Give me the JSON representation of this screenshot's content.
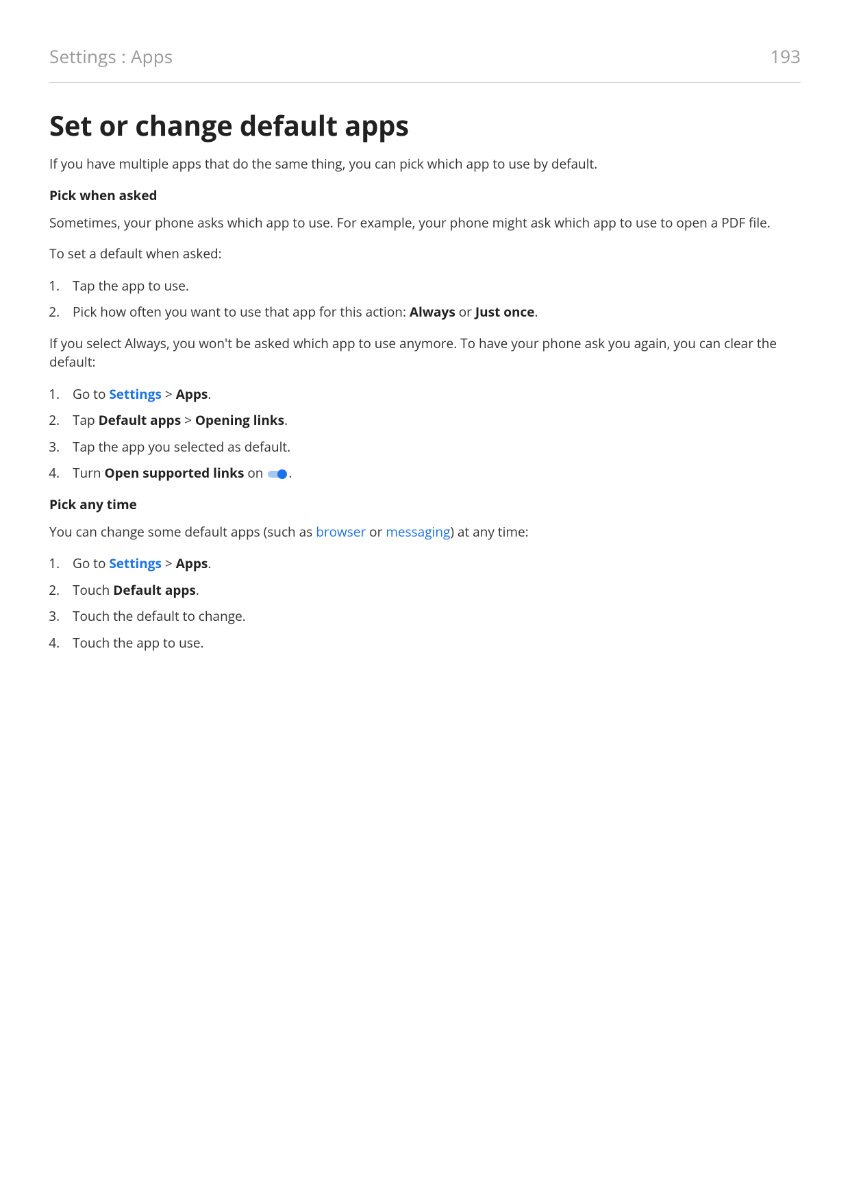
{
  "header": {
    "breadcrumb": "Settings : Apps",
    "page_number": "193"
  },
  "title": "Set or change default apps",
  "intro": "If you have multiple apps that do the same thing, you can pick which app to use by default.",
  "section1": {
    "heading": "Pick when asked",
    "para1": "Sometimes, your phone asks which app to use. For example, your phone might ask which app to use to open a PDF file.",
    "para2": "To set a default when asked:",
    "list1": {
      "item1": "Tap the app to use.",
      "item2_pre": "Pick how often you want to use that app for this action: ",
      "item2_bold1": "Always",
      "item2_mid": " or ",
      "item2_bold2": "Just once",
      "item2_post": "."
    },
    "para3": "If you select Always, you won't be asked which app to use anymore. To have your phone ask you again, you can clear the default:",
    "list2": {
      "item1_pre": "Go to ",
      "item1_link": "Settings",
      "item1_mid": " > ",
      "item1_bold": "Apps",
      "item1_post": ".",
      "item2_pre": "Tap ",
      "item2_bold1": "Default apps",
      "item2_mid": " > ",
      "item2_bold2": "Opening links",
      "item2_post": ".",
      "item3": "Tap the app you selected as default.",
      "item4_pre": "Turn ",
      "item4_bold": "Open supported links",
      "item4_mid": " on ",
      "item4_post": "."
    }
  },
  "section2": {
    "heading": "Pick any time",
    "para1_pre": "You can change some default apps (such as ",
    "para1_link1": "browser",
    "para1_mid": " or ",
    "para1_link2": "messaging",
    "para1_post": ") at any time:",
    "list1": {
      "item1_pre": "Go to ",
      "item1_link": "Settings",
      "item1_mid": " > ",
      "item1_bold": "Apps",
      "item1_post": ".",
      "item2_pre": "Touch ",
      "item2_bold": "Default apps",
      "item2_post": ".",
      "item3": "Touch the default to change.",
      "item4": "Touch the app to use."
    }
  }
}
